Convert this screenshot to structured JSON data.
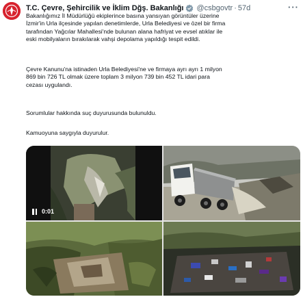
{
  "account": {
    "display_name": "T.C. Çevre, Şehircilik ve İklim Dğş. Bakanlığı",
    "handle": "@csbgovtr",
    "separator": "·",
    "time": "57d",
    "more_label": "···",
    "avatar_icon": "ministry-logo-icon",
    "verified_icon": "government-verified-badge-icon",
    "verified_color": "#829aab",
    "brand_color": "#d7232e"
  },
  "tweet": {
    "paragraphs": [
      "Bakanlığımız İl Müdürlüğü ekiplerince basına yansıyan görüntüler üzerine\nİzmir'in Urla ilçesinde yapılan denetimlerde, Urla Belediyesi ve özel bir firma\ntarafından Yağcılar Mahallesi'nde bulunan alana hafriyat ve evsel atıklar ile\neski mobilyaların bırakılarak vahşi depolama yapıldığı tespit edildi.",
      "Çevre Kanunu'na istinaden Urla Belediyesi'ne ve firmaya ayrı ayrı 1 milyon\n869 bin 726 TL olmak üzere toplam 3 milyon 739 bin 452 TL idari para\ncezası  uygulandı.",
      "Sorumlular hakkında suç duyurusunda bulunuldu.",
      "Kamuoyuna saygıyla duyurulur."
    ]
  },
  "media": {
    "video_time": "0:01",
    "pause_icon": "pause-icon"
  }
}
